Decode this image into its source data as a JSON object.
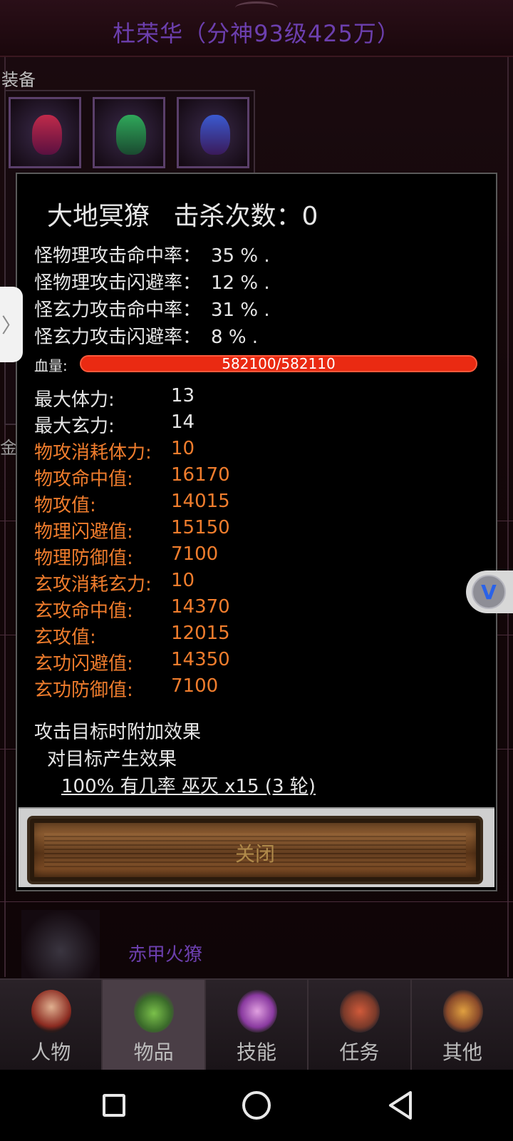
{
  "header": {
    "character_title": "杜荣华（分神93级425万）"
  },
  "equipment": {
    "label": "装备"
  },
  "gold_label": "金",
  "list_row": {
    "name": "赤甲火獠"
  },
  "dialog": {
    "monster_name": "大地冥獠",
    "kill_label": "击杀次数：",
    "kill_count": "0",
    "rates": [
      {
        "label": "怪物理攻击命中率：",
        "value": "35 % ."
      },
      {
        "label": "怪物理攻击闪避率：",
        "value": "12 % ."
      },
      {
        "label": "怪玄力攻击命中率：",
        "value": "31 % ."
      },
      {
        "label": "怪玄力攻击闪避率：",
        "value": "8 % ."
      }
    ],
    "hp": {
      "label": "血量:",
      "text": "582100/582110",
      "fraction": 0.99998
    },
    "attributes": [
      {
        "label": "最大体力:",
        "value": "13",
        "color": "white"
      },
      {
        "label": "最大玄力:",
        "value": "14",
        "color": "white"
      },
      {
        "label": "物攻消耗体力:",
        "value": "10",
        "color": "orange"
      },
      {
        "label": "物攻命中值:",
        "value": "16170",
        "color": "orange"
      },
      {
        "label": "物攻值:",
        "value": "14015",
        "color": "orange"
      },
      {
        "label": "物理闪避值:",
        "value": "15150",
        "color": "orange"
      },
      {
        "label": "物理防御值:",
        "value": "7100",
        "color": "orange"
      },
      {
        "label": "玄攻消耗玄力:",
        "value": "10",
        "color": "orange"
      },
      {
        "label": "玄攻命中值:",
        "value": "14370",
        "color": "orange"
      },
      {
        "label": "玄攻值:",
        "value": "12015",
        "color": "orange"
      },
      {
        "label": "玄功闪避值:",
        "value": "14350",
        "color": "orange"
      },
      {
        "label": "玄功防御值:",
        "value": "7100",
        "color": "orange"
      }
    ],
    "effect_heading": "攻击目标时附加效果",
    "effect_sub": "对目标产生效果",
    "effect_detail": "100% 有几率 巫灭 x15 (3 轮)",
    "close_label": "关闭"
  },
  "tabs": [
    {
      "label": "人物",
      "icon": "character-icon",
      "active": false
    },
    {
      "label": "物品",
      "icon": "potion-icon",
      "active": true
    },
    {
      "label": "技能",
      "icon": "skill-orb-icon",
      "active": false
    },
    {
      "label": "任务",
      "icon": "quest-icon",
      "active": false
    },
    {
      "label": "其他",
      "icon": "other-icon",
      "active": false
    }
  ],
  "colors": {
    "title_purple": "#6c3fae",
    "stat_orange": "#f07d2d",
    "hp_red": "#ea2a12",
    "text_white": "#e6e6e6"
  },
  "side_tab_glyph": "〉",
  "float_button_glyph": "V"
}
